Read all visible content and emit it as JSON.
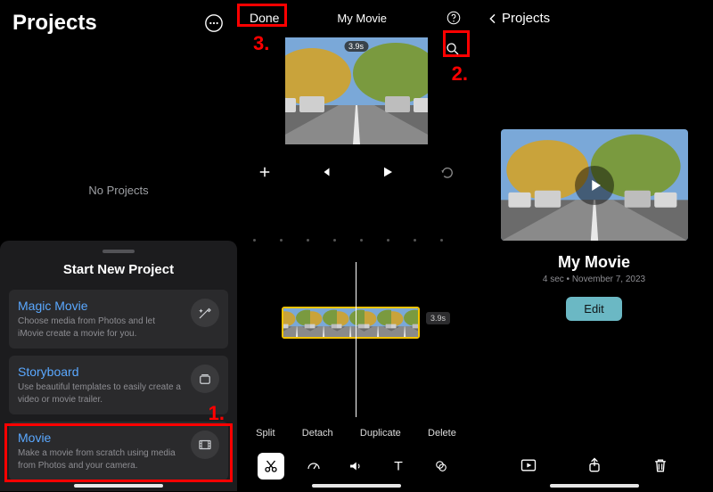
{
  "annotations": {
    "step1": "1.",
    "step2": "2.",
    "step3": "3."
  },
  "panel1": {
    "title": "Projects",
    "empty": "No Projects",
    "sheet_title": "Start New Project",
    "options": [
      {
        "title": "Magic Movie",
        "desc": "Choose media from Photos and let iMovie create a movie for you.",
        "icon": "magic-wand-icon"
      },
      {
        "title": "Storyboard",
        "desc": "Use beautiful templates to easily create a video or movie trailer.",
        "icon": "storyboard-icon"
      },
      {
        "title": "Movie",
        "desc": "Make a movie from scratch using media from Photos and your camera.",
        "icon": "filmstrip-icon"
      }
    ]
  },
  "panel2": {
    "done": "Done",
    "title": "My Movie",
    "clip_duration": "3.9s",
    "clip_duration_label": "3.9s",
    "tools_text": {
      "split": "Split",
      "detach": "Detach",
      "duplicate": "Duplicate",
      "delete": "Delete"
    }
  },
  "panel3": {
    "back": "Projects",
    "project_name": "My Movie",
    "meta": "4 sec • November 7, 2023",
    "edit": "Edit"
  }
}
